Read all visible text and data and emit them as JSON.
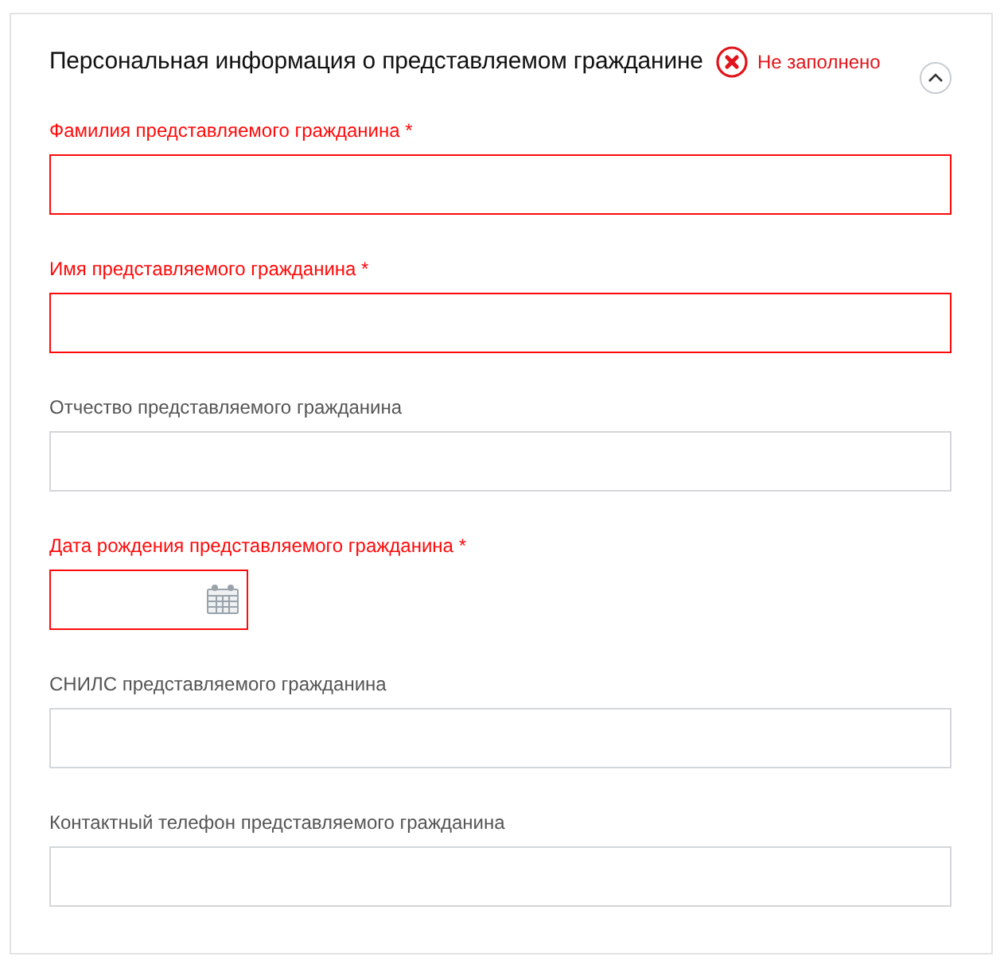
{
  "section": {
    "title": "Персональная информация о представляемом гражданине",
    "status": "Не заполнено",
    "expanded": true
  },
  "fields": [
    {
      "kind": "text",
      "label": "Фамилия представляемого гражданина",
      "required_mark": "*",
      "invalid": true
    },
    {
      "kind": "text",
      "label": "Имя представляемого гражданина",
      "required_mark": "*",
      "invalid": true
    },
    {
      "kind": "text",
      "label": "Отчество представляемого гражданина",
      "invalid": false
    },
    {
      "kind": "date",
      "label": "Дата рождения представляемого гражданина",
      "required_mark": "*",
      "invalid": true
    },
    {
      "kind": "text",
      "label": "СНИЛС представляемого гражданина",
      "invalid": false
    },
    {
      "kind": "text",
      "label": "Контактный телефон представляемого гражданина",
      "invalid": false
    }
  ]
}
